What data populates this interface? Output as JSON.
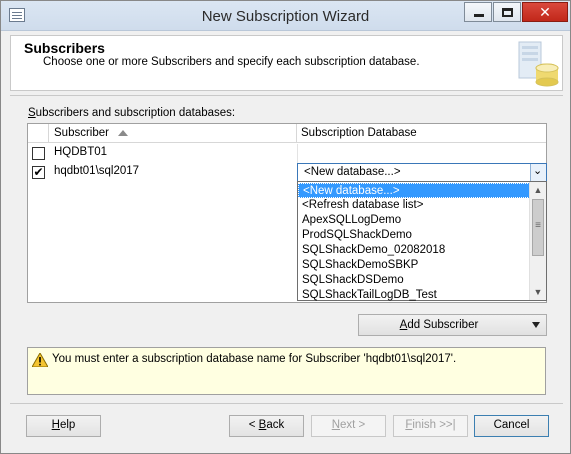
{
  "window": {
    "title": "New Subscription Wizard",
    "close_glyph": "✕"
  },
  "header": {
    "title": "Subscribers",
    "subtitle": "Choose one or more Subscribers and specify each subscription database."
  },
  "grid": {
    "label_prefix": "",
    "label_mnemonic": "S",
    "label_rest": "ubscribers and subscription databases:",
    "columns": {
      "subscriber": "Subscriber",
      "database": "Subscription Database"
    },
    "rows": [
      {
        "checked": false,
        "name": "HQDBT01",
        "database": ""
      },
      {
        "checked": true,
        "name": "hqdbt01\\sql2017",
        "database": "<New database...>"
      }
    ]
  },
  "combo": {
    "value": "<New database...>",
    "arrow_glyph": "⌄"
  },
  "dropdown": {
    "items": [
      "<New database...>",
      "<Refresh database list>",
      "ApexSQLLogDemo",
      "ProdSQLShackDemo",
      "SQLShackDemo_02082018",
      "SQLShackDemoSBKP",
      "SQLShackDSDemo",
      "SQLShackTailLogDB_Test"
    ],
    "selected_index": 0,
    "scroll_up_glyph": "▲",
    "scroll_down_glyph": "▼"
  },
  "add_subscriber": {
    "mnemonic": "A",
    "rest": "dd Subscriber"
  },
  "message": {
    "text": "You must enter a subscription database name for Subscriber 'hqdbt01\\sql2017'."
  },
  "footer": {
    "help": {
      "mnemonic": "H",
      "rest": "elp"
    },
    "back": {
      "prefix": "< ",
      "mnemonic": "B",
      "rest": "ack"
    },
    "next": {
      "mnemonic": "N",
      "rest": "ext >"
    },
    "finish": {
      "mnemonic": "F",
      "rest": "inish >>|"
    },
    "cancel": "Cancel"
  },
  "colors": {
    "selection": "#3399ff",
    "message_bg": "#ffffe1",
    "close_button": "#c1271a"
  },
  "checkmark_glyph": "✔"
}
